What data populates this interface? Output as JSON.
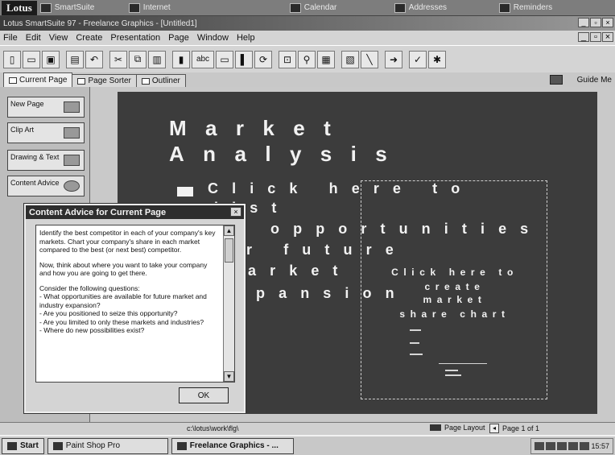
{
  "suite": {
    "logo": "Lotus",
    "items": [
      {
        "label": "SmartSuite",
        "icon": "smartsuite-icon"
      },
      {
        "label": "Internet",
        "icon": "globe-icon"
      },
      {
        "label": "Calendar",
        "icon": "calendar-icon"
      },
      {
        "label": "Addresses",
        "icon": "addresses-icon"
      },
      {
        "label": "Reminders",
        "icon": "reminders-icon"
      }
    ]
  },
  "titlebar": {
    "title": "Lotus SmartSuite 97  -  Freelance Graphics - [Untitled1]"
  },
  "menu": [
    "File",
    "Edit",
    "View",
    "Create",
    "Presentation",
    "Page",
    "Window",
    "Help"
  ],
  "toolbar": {
    "icons": [
      "new-icon",
      "open-icon",
      "save-icon",
      "print-icon",
      "undo-icon",
      "cut-icon",
      "copy-icon",
      "paste-icon",
      "chart-icon",
      "text-abc-icon",
      "shape-icon",
      "color-icon",
      "group-icon",
      "zoom-icon",
      "align-icon",
      "layout-icon",
      "arrow-icon",
      "spell-icon",
      "star-icon"
    ],
    "text_button": "abc"
  },
  "tabs": [
    {
      "label": "Current Page",
      "active": true
    },
    {
      "label": "Page Sorter",
      "active": false
    },
    {
      "label": "Outliner",
      "active": false
    }
  ],
  "guide_label": "Guide Me",
  "left_panel": {
    "buttons": [
      {
        "label": "New Page",
        "icon": "new-page-icon"
      },
      {
        "label": "Clip Art",
        "icon": "clip-art-icon"
      },
      {
        "label": "Drawing & Text",
        "icon": "drawing-icon"
      },
      {
        "label": "Content Advice",
        "icon": "content-advice-icon"
      }
    ]
  },
  "slide": {
    "title_line1": "Market",
    "title_line2": "Analysis",
    "bullet_lines": [
      "Click  here  to",
      "list",
      "opportunities",
      "r  future",
      "arket",
      "pansion"
    ],
    "chart_placeholder": [
      "Click here to",
      "create",
      "market",
      "share chart"
    ]
  },
  "dialog": {
    "title": "Content Advice for Current Page",
    "paragraphs": [
      "Identify the best competitor in each of your company's key markets. Chart your company's share in each market compared to the best (or next best) competitor.",
      "Now, think about where you want to take your company and how you are going to get there.",
      "Consider the following questions:",
      "- What opportunities are available for future market and industry expansion?",
      "- Are you positioned to seize this opportunity?",
      "- Are you limited to only these markets and industries?",
      "- Where do new possibilities exist?"
    ],
    "ok_label": "OK"
  },
  "status": {
    "path": "c:\\lotus\\work\\flg\\",
    "layout": "Page Layout",
    "page": "Page 1 of 1"
  },
  "taskbar": {
    "start": "Start",
    "tasks": [
      "Paint Shop Pro",
      "Freelance Graphics - ..."
    ],
    "clock": "15:57"
  }
}
